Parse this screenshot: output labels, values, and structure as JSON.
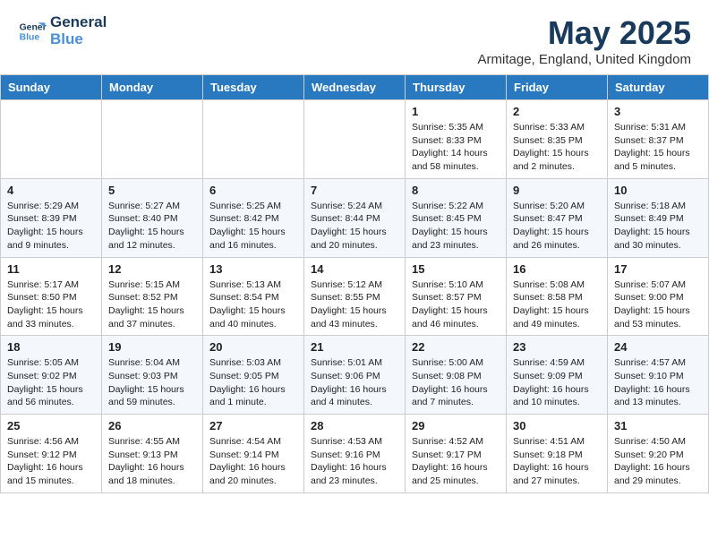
{
  "header": {
    "logo_line1": "General",
    "logo_line2": "Blue",
    "month": "May 2025",
    "location": "Armitage, England, United Kingdom"
  },
  "weekdays": [
    "Sunday",
    "Monday",
    "Tuesday",
    "Wednesday",
    "Thursday",
    "Friday",
    "Saturday"
  ],
  "weeks": [
    [
      {
        "day": "",
        "info": ""
      },
      {
        "day": "",
        "info": ""
      },
      {
        "day": "",
        "info": ""
      },
      {
        "day": "",
        "info": ""
      },
      {
        "day": "1",
        "info": "Sunrise: 5:35 AM\nSunset: 8:33 PM\nDaylight: 14 hours and 58 minutes."
      },
      {
        "day": "2",
        "info": "Sunrise: 5:33 AM\nSunset: 8:35 PM\nDaylight: 15 hours and 2 minutes."
      },
      {
        "day": "3",
        "info": "Sunrise: 5:31 AM\nSunset: 8:37 PM\nDaylight: 15 hours and 5 minutes."
      }
    ],
    [
      {
        "day": "4",
        "info": "Sunrise: 5:29 AM\nSunset: 8:39 PM\nDaylight: 15 hours and 9 minutes."
      },
      {
        "day": "5",
        "info": "Sunrise: 5:27 AM\nSunset: 8:40 PM\nDaylight: 15 hours and 12 minutes."
      },
      {
        "day": "6",
        "info": "Sunrise: 5:25 AM\nSunset: 8:42 PM\nDaylight: 15 hours and 16 minutes."
      },
      {
        "day": "7",
        "info": "Sunrise: 5:24 AM\nSunset: 8:44 PM\nDaylight: 15 hours and 20 minutes."
      },
      {
        "day": "8",
        "info": "Sunrise: 5:22 AM\nSunset: 8:45 PM\nDaylight: 15 hours and 23 minutes."
      },
      {
        "day": "9",
        "info": "Sunrise: 5:20 AM\nSunset: 8:47 PM\nDaylight: 15 hours and 26 minutes."
      },
      {
        "day": "10",
        "info": "Sunrise: 5:18 AM\nSunset: 8:49 PM\nDaylight: 15 hours and 30 minutes."
      }
    ],
    [
      {
        "day": "11",
        "info": "Sunrise: 5:17 AM\nSunset: 8:50 PM\nDaylight: 15 hours and 33 minutes."
      },
      {
        "day": "12",
        "info": "Sunrise: 5:15 AM\nSunset: 8:52 PM\nDaylight: 15 hours and 37 minutes."
      },
      {
        "day": "13",
        "info": "Sunrise: 5:13 AM\nSunset: 8:54 PM\nDaylight: 15 hours and 40 minutes."
      },
      {
        "day": "14",
        "info": "Sunrise: 5:12 AM\nSunset: 8:55 PM\nDaylight: 15 hours and 43 minutes."
      },
      {
        "day": "15",
        "info": "Sunrise: 5:10 AM\nSunset: 8:57 PM\nDaylight: 15 hours and 46 minutes."
      },
      {
        "day": "16",
        "info": "Sunrise: 5:08 AM\nSunset: 8:58 PM\nDaylight: 15 hours and 49 minutes."
      },
      {
        "day": "17",
        "info": "Sunrise: 5:07 AM\nSunset: 9:00 PM\nDaylight: 15 hours and 53 minutes."
      }
    ],
    [
      {
        "day": "18",
        "info": "Sunrise: 5:05 AM\nSunset: 9:02 PM\nDaylight: 15 hours and 56 minutes."
      },
      {
        "day": "19",
        "info": "Sunrise: 5:04 AM\nSunset: 9:03 PM\nDaylight: 15 hours and 59 minutes."
      },
      {
        "day": "20",
        "info": "Sunrise: 5:03 AM\nSunset: 9:05 PM\nDaylight: 16 hours and 1 minute."
      },
      {
        "day": "21",
        "info": "Sunrise: 5:01 AM\nSunset: 9:06 PM\nDaylight: 16 hours and 4 minutes."
      },
      {
        "day": "22",
        "info": "Sunrise: 5:00 AM\nSunset: 9:08 PM\nDaylight: 16 hours and 7 minutes."
      },
      {
        "day": "23",
        "info": "Sunrise: 4:59 AM\nSunset: 9:09 PM\nDaylight: 16 hours and 10 minutes."
      },
      {
        "day": "24",
        "info": "Sunrise: 4:57 AM\nSunset: 9:10 PM\nDaylight: 16 hours and 13 minutes."
      }
    ],
    [
      {
        "day": "25",
        "info": "Sunrise: 4:56 AM\nSunset: 9:12 PM\nDaylight: 16 hours and 15 minutes."
      },
      {
        "day": "26",
        "info": "Sunrise: 4:55 AM\nSunset: 9:13 PM\nDaylight: 16 hours and 18 minutes."
      },
      {
        "day": "27",
        "info": "Sunrise: 4:54 AM\nSunset: 9:14 PM\nDaylight: 16 hours and 20 minutes."
      },
      {
        "day": "28",
        "info": "Sunrise: 4:53 AM\nSunset: 9:16 PM\nDaylight: 16 hours and 23 minutes."
      },
      {
        "day": "29",
        "info": "Sunrise: 4:52 AM\nSunset: 9:17 PM\nDaylight: 16 hours and 25 minutes."
      },
      {
        "day": "30",
        "info": "Sunrise: 4:51 AM\nSunset: 9:18 PM\nDaylight: 16 hours and 27 minutes."
      },
      {
        "day": "31",
        "info": "Sunrise: 4:50 AM\nSunset: 9:20 PM\nDaylight: 16 hours and 29 minutes."
      }
    ]
  ]
}
